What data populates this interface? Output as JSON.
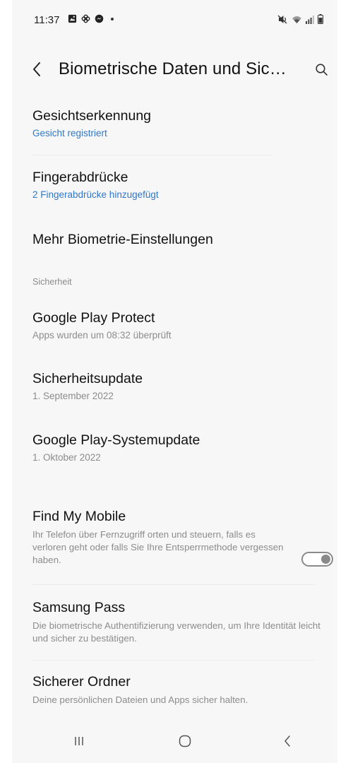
{
  "status_bar": {
    "time": "11:37",
    "left_icons": [
      "gallery-icon",
      "pinwheel-icon",
      "messenger-icon"
    ],
    "right_icons": [
      "mute-icon",
      "wifi-icon",
      "signal-icon",
      "battery-icon"
    ]
  },
  "header": {
    "title": "Biometrische Daten und Sic…"
  },
  "items": {
    "face": {
      "title": "Gesichtserkennung",
      "subtitle": "Gesicht registriert"
    },
    "fingerprint": {
      "title": "Fingerabdrücke",
      "subtitle": "2 Fingerabdrücke hinzugefügt"
    },
    "more_biometrics": {
      "title": "Mehr Biometrie-Einstellungen"
    }
  },
  "security_section": {
    "header": "Sicherheit",
    "play_protect": {
      "title": "Google Play Protect",
      "subtitle": "Apps wurden um 08:32 überprüft"
    },
    "security_update": {
      "title": "Sicherheitsupdate",
      "subtitle": "1. September 2022"
    },
    "system_update": {
      "title": "Google Play-Systemupdate",
      "subtitle": "1. Oktober 2022"
    }
  },
  "more_items": {
    "find_my_mobile": {
      "title": "Find My Mobile",
      "desc": "Ihr Telefon über Fernzugriff orten und steuern, falls es verloren geht oder falls Sie Ihre Entsperrmethode vergessen haben.",
      "toggle_on": false
    },
    "samsung_pass": {
      "title": "Samsung Pass",
      "desc": "Die biometrische Authentifizierung verwenden, um Ihre Identität leicht und sicher zu bestätigen."
    },
    "secure_folder": {
      "title": "Sicherer Ordner",
      "desc": "Deine persönlichen Dateien und Apps sicher halten."
    }
  },
  "nav_bar": {
    "buttons": [
      "recents-icon",
      "home-icon",
      "back-icon"
    ]
  },
  "colors": {
    "accent": "#2f77c9",
    "background": "#f7f7f7",
    "secondary_text": "#8c8c8c"
  }
}
